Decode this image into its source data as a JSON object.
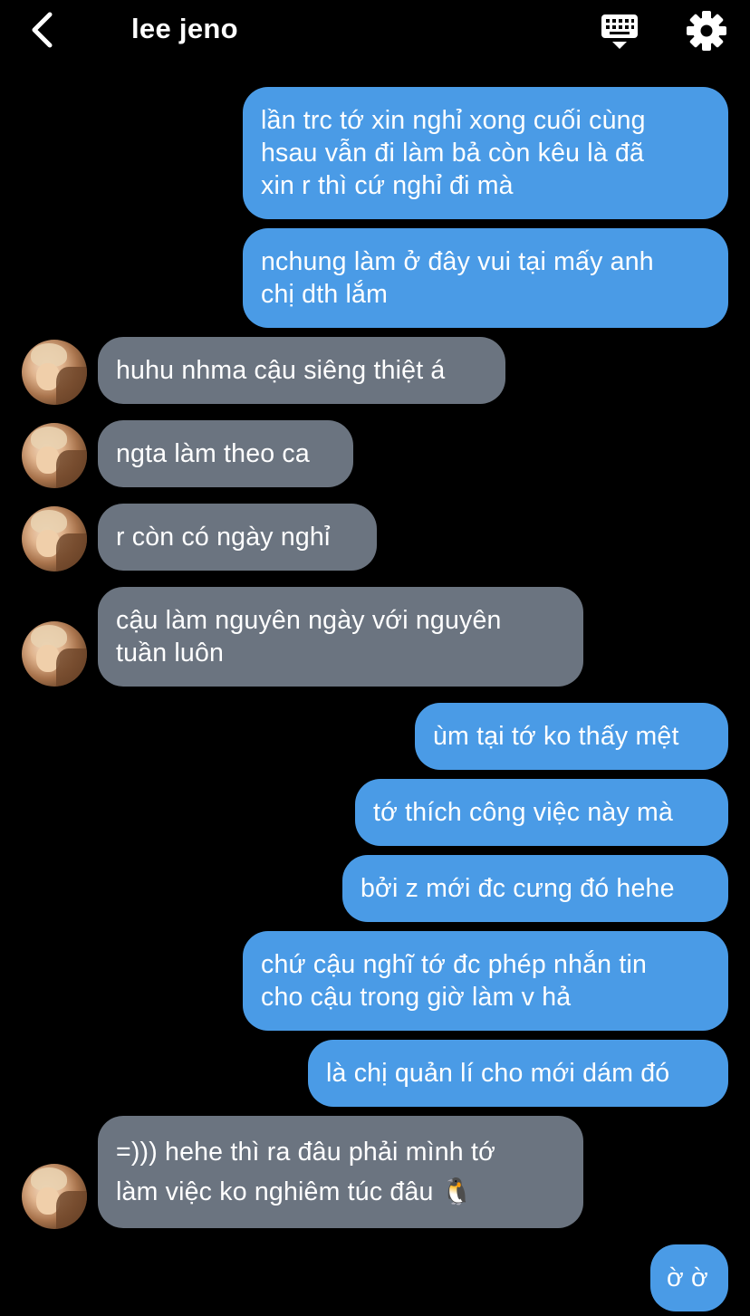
{
  "header": {
    "back_icon": "chevron-left-icon",
    "title": "lee jeno",
    "keyboard_icon": "keyboard-icon",
    "settings_icon": "gear-icon"
  },
  "colors": {
    "background": "#000000",
    "outgoing_bubble": "#4a9be6",
    "incoming_bubble": "#6b7480",
    "text": "#ffffff"
  },
  "messages": [
    {
      "side": "out",
      "text": "lần trc tớ xin nghỉ xong cuối cùng\nhsau vẫn đi làm bả còn kêu là đã\nxin r thì cứ nghỉ đi mà"
    },
    {
      "side": "out",
      "text": "nchung làm ở đây vui tại mấy anh\nchị dth lắm"
    },
    {
      "side": "in",
      "text": "huhu nhma cậu siêng thiệt á"
    },
    {
      "side": "in",
      "text": "ngta làm theo ca"
    },
    {
      "side": "in",
      "text": "r còn có ngày nghỉ"
    },
    {
      "side": "in",
      "text": "cậu làm nguyên ngày với nguyên\ntuần luôn"
    },
    {
      "side": "out",
      "text": "ùm tại tớ ko thấy mệt"
    },
    {
      "side": "out",
      "text": "tớ thích công việc này mà"
    },
    {
      "side": "out",
      "text": "bởi z mới đc cưng đó hehe"
    },
    {
      "side": "out",
      "text": "chứ cậu nghĩ tớ đc phép nhắn tin\ncho cậu trong giờ làm v hả"
    },
    {
      "side": "out",
      "text": "là chị quản lí cho mới dám đó"
    },
    {
      "side": "in",
      "text": "=))) hehe thì ra đâu phải mình tớ\nlàm việc ko nghiêm túc đâu 🐧"
    },
    {
      "side": "out",
      "text": "ờ ờ"
    }
  ]
}
